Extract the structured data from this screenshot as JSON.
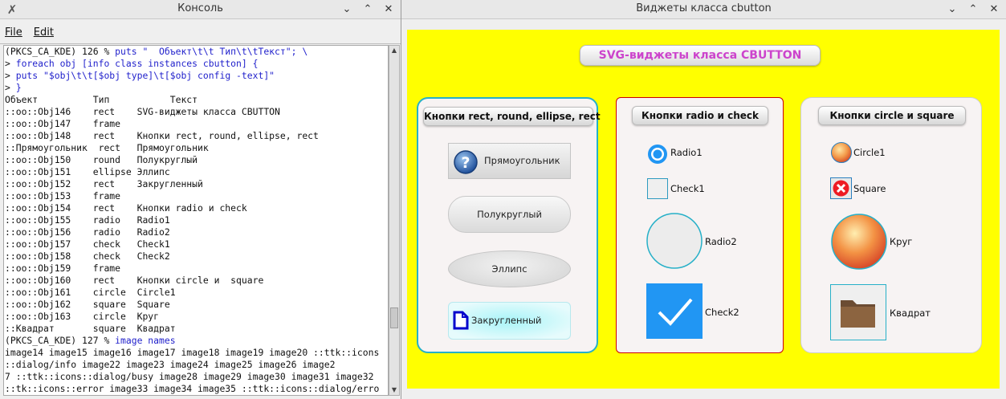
{
  "console": {
    "title": "Консоль",
    "menu": {
      "file": "File",
      "edit": "Edit"
    },
    "lines": [
      {
        "t": "(PKCS_CA_KDE) 126 % ",
        "c": "puts \"  Объект\\t\\t Тип\\t\\tТекст\"; \\"
      },
      {
        "t": "> ",
        "c": "foreach obj [info class instances cbutton] {"
      },
      {
        "t": "> ",
        "c": "puts \"$obj\\t\\t[$obj type]\\t[$obj config -text]\""
      },
      {
        "t": "> ",
        "c": "}"
      },
      {
        "t": "Объект          Тип           Текст",
        "c": ""
      },
      {
        "t": "::oo::Obj146    rect    SVG-виджеты класса CBUTTON",
        "c": ""
      },
      {
        "t": "::oo::Obj147    frame",
        "c": ""
      },
      {
        "t": "::oo::Obj148    rect    Кнопки rect, round, ellipse, rect",
        "c": ""
      },
      {
        "t": "::Прямоугольник  rect   Прямоугольник",
        "c": ""
      },
      {
        "t": "::oo::Obj150    round   Полукруглый",
        "c": ""
      },
      {
        "t": "::oo::Obj151    ellipse Эллипс",
        "c": ""
      },
      {
        "t": "::oo::Obj152    rect    Закругленный",
        "c": ""
      },
      {
        "t": "::oo::Obj153    frame",
        "c": ""
      },
      {
        "t": "::oo::Obj154    rect    Кнопки radio и check",
        "c": ""
      },
      {
        "t": "::oo::Obj155    radio   Radio1",
        "c": ""
      },
      {
        "t": "::oo::Obj156    radio   Radio2",
        "c": ""
      },
      {
        "t": "::oo::Obj157    check   Check1",
        "c": ""
      },
      {
        "t": "::oo::Obj158    check   Check2",
        "c": ""
      },
      {
        "t": "::oo::Obj159    frame",
        "c": ""
      },
      {
        "t": "::oo::Obj160    rect    Кнопки circle и  square",
        "c": ""
      },
      {
        "t": "::oo::Obj161    circle  Circle1",
        "c": ""
      },
      {
        "t": "::oo::Obj162    square  Square",
        "c": ""
      },
      {
        "t": "::oo::Obj163    circle  Круг",
        "c": ""
      },
      {
        "t": "::Квадрат       square  Квадрат",
        "c": ""
      },
      {
        "t": "(PKCS_CA_KDE) 127 % ",
        "c": "image names"
      },
      {
        "t": "image14 image15 image16 image17 image18 image19 image20 ::ttk::icons",
        "c": ""
      },
      {
        "t": "::dialog/info image22 image23 image24 image25 image26 image2",
        "c": ""
      },
      {
        "t": "7 ::ttk::icons::dialog/busy image28 image29 image30 image31 image32",
        "c": ""
      },
      {
        "t": "::tk::icons::error image33 image34 image35 ::ttk::icons::dialog/erro",
        "c": ""
      }
    ]
  },
  "widgets": {
    "title": "Виджеты класса cbutton",
    "caption": "SVG-виджеты класса CBUTTON",
    "frame1": {
      "header": "Кнопки rect, round, ellipse, rect",
      "rect": "Прямоугольник",
      "round": "Полукруглый",
      "ellipse": "Эллипс",
      "rounded": "Закругленный"
    },
    "frame2": {
      "header": "Кнопки radio и check",
      "radio1": "Radio1",
      "check1": "Check1",
      "radio2": "Radio2",
      "check2": "Check2"
    },
    "frame3": {
      "header": "Кнопки circle и  square",
      "circle1": "Circle1",
      "square": "Square",
      "circle": "Круг",
      "square2": "Квадрат"
    }
  },
  "colors": {
    "stage": "#ffff00",
    "frame1_border": "#26b0c8",
    "frame2_border": "#cc0000",
    "caption_text": "#cc44cc",
    "accent_blue": "#2196f3"
  }
}
